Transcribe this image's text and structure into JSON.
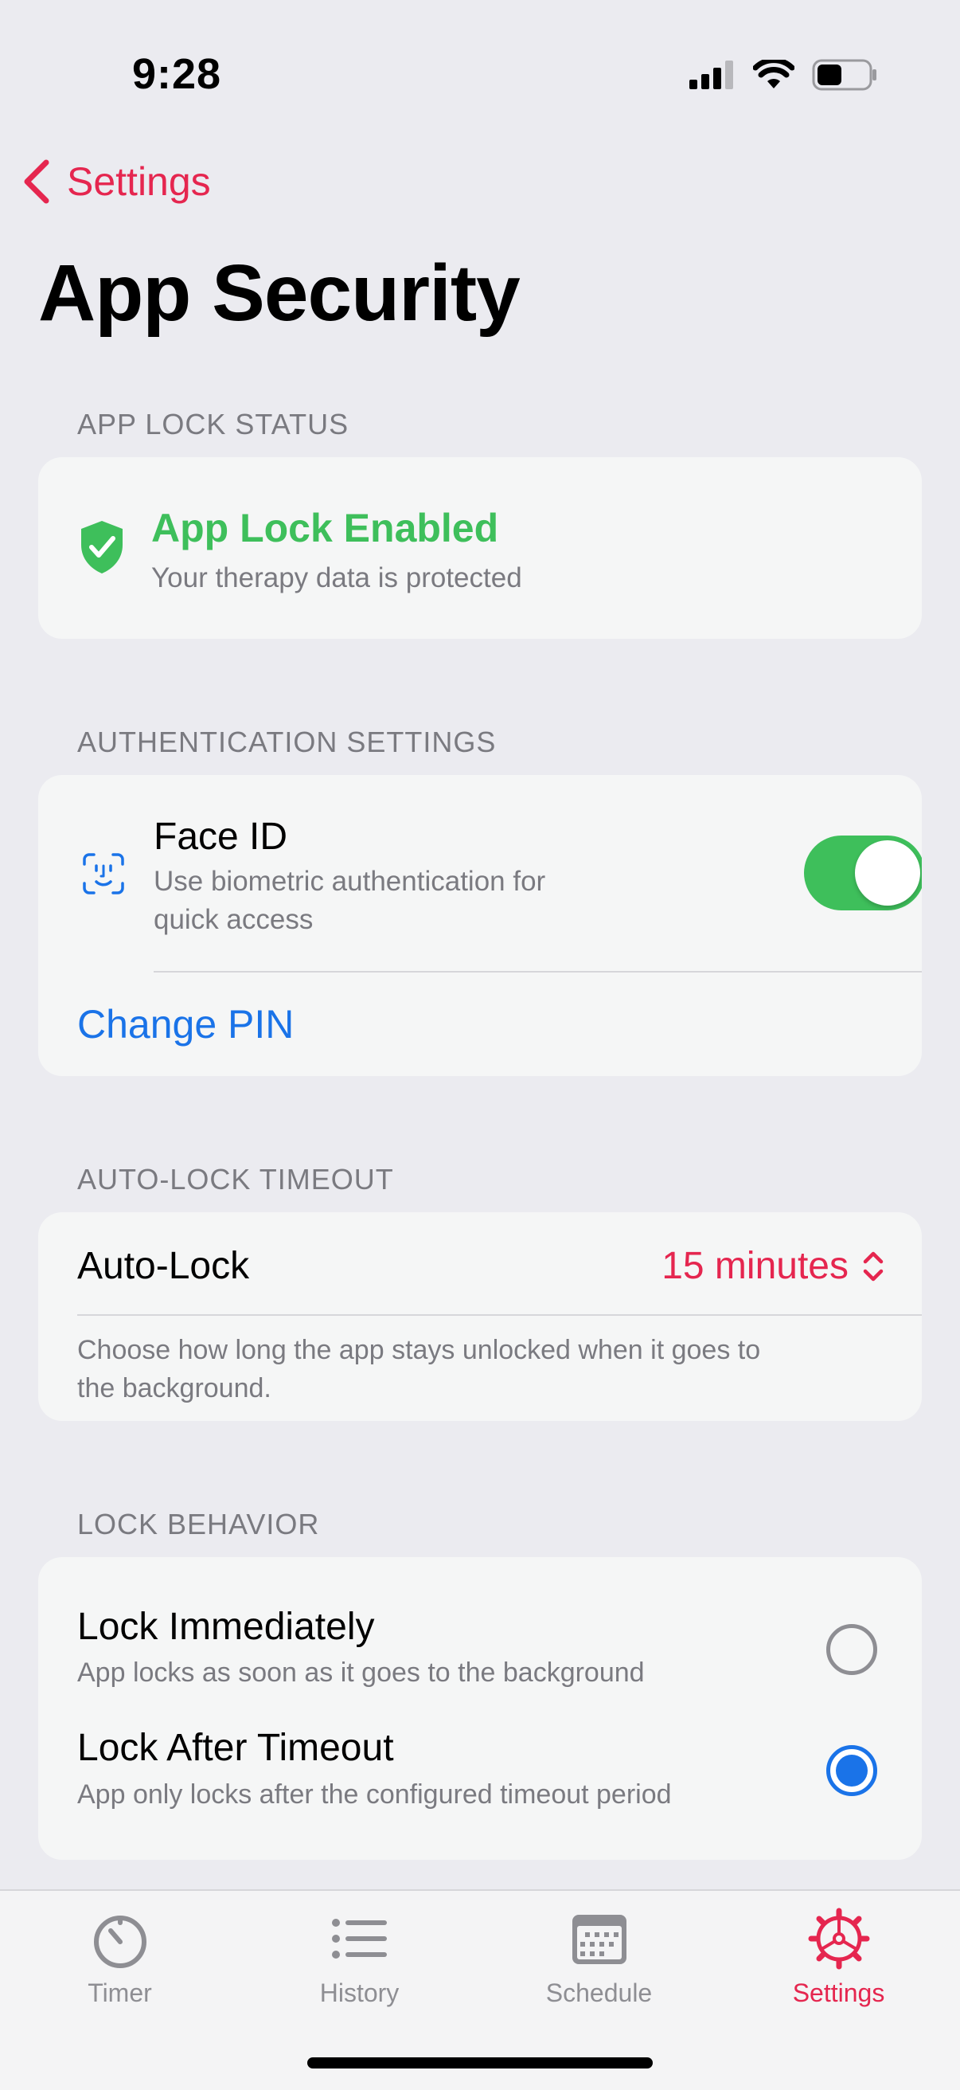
{
  "status_bar": {
    "time": "9:28"
  },
  "nav": {
    "back_label": "Settings"
  },
  "page": {
    "title": "App Security"
  },
  "sections": {
    "app_lock_status": {
      "header": "APP LOCK STATUS",
      "title": "App Lock Enabled",
      "subtitle": "Your therapy data is protected",
      "icon": "shield-check-icon"
    },
    "authentication": {
      "header": "AUTHENTICATION SETTINGS",
      "face_id_title": "Face ID",
      "face_id_subtitle_line1": "Use biometric authentication for",
      "face_id_subtitle_line2": "quick access",
      "face_id_enabled": true,
      "change_pin_label": "Change PIN"
    },
    "auto_lock": {
      "header": "AUTO-LOCK TIMEOUT",
      "label": "Auto-Lock",
      "value": "15 minutes",
      "description_line1": "Choose how long the app stays unlocked when it goes to",
      "description_line2": "the background."
    },
    "lock_behavior": {
      "header": "LOCK BEHAVIOR",
      "options": [
        {
          "title": "Lock Immediately",
          "subtitle": "App locks as soon as it goes to the background",
          "selected": false
        },
        {
          "title": "Lock After Timeout",
          "subtitle": "App only locks after the configured timeout period",
          "selected": true
        }
      ]
    }
  },
  "tab_bar": {
    "tabs": [
      {
        "label": "Timer",
        "icon": "timer-icon",
        "active": false
      },
      {
        "label": "History",
        "icon": "list-icon",
        "active": false
      },
      {
        "label": "Schedule",
        "icon": "calendar-icon",
        "active": false
      },
      {
        "label": "Settings",
        "icon": "gear-icon",
        "active": true
      }
    ]
  },
  "colors": {
    "accent": "#e5264f",
    "success": "#3ebf5b",
    "link": "#1a73e8",
    "background": "#ebebf0",
    "card": "#f5f6f6"
  }
}
